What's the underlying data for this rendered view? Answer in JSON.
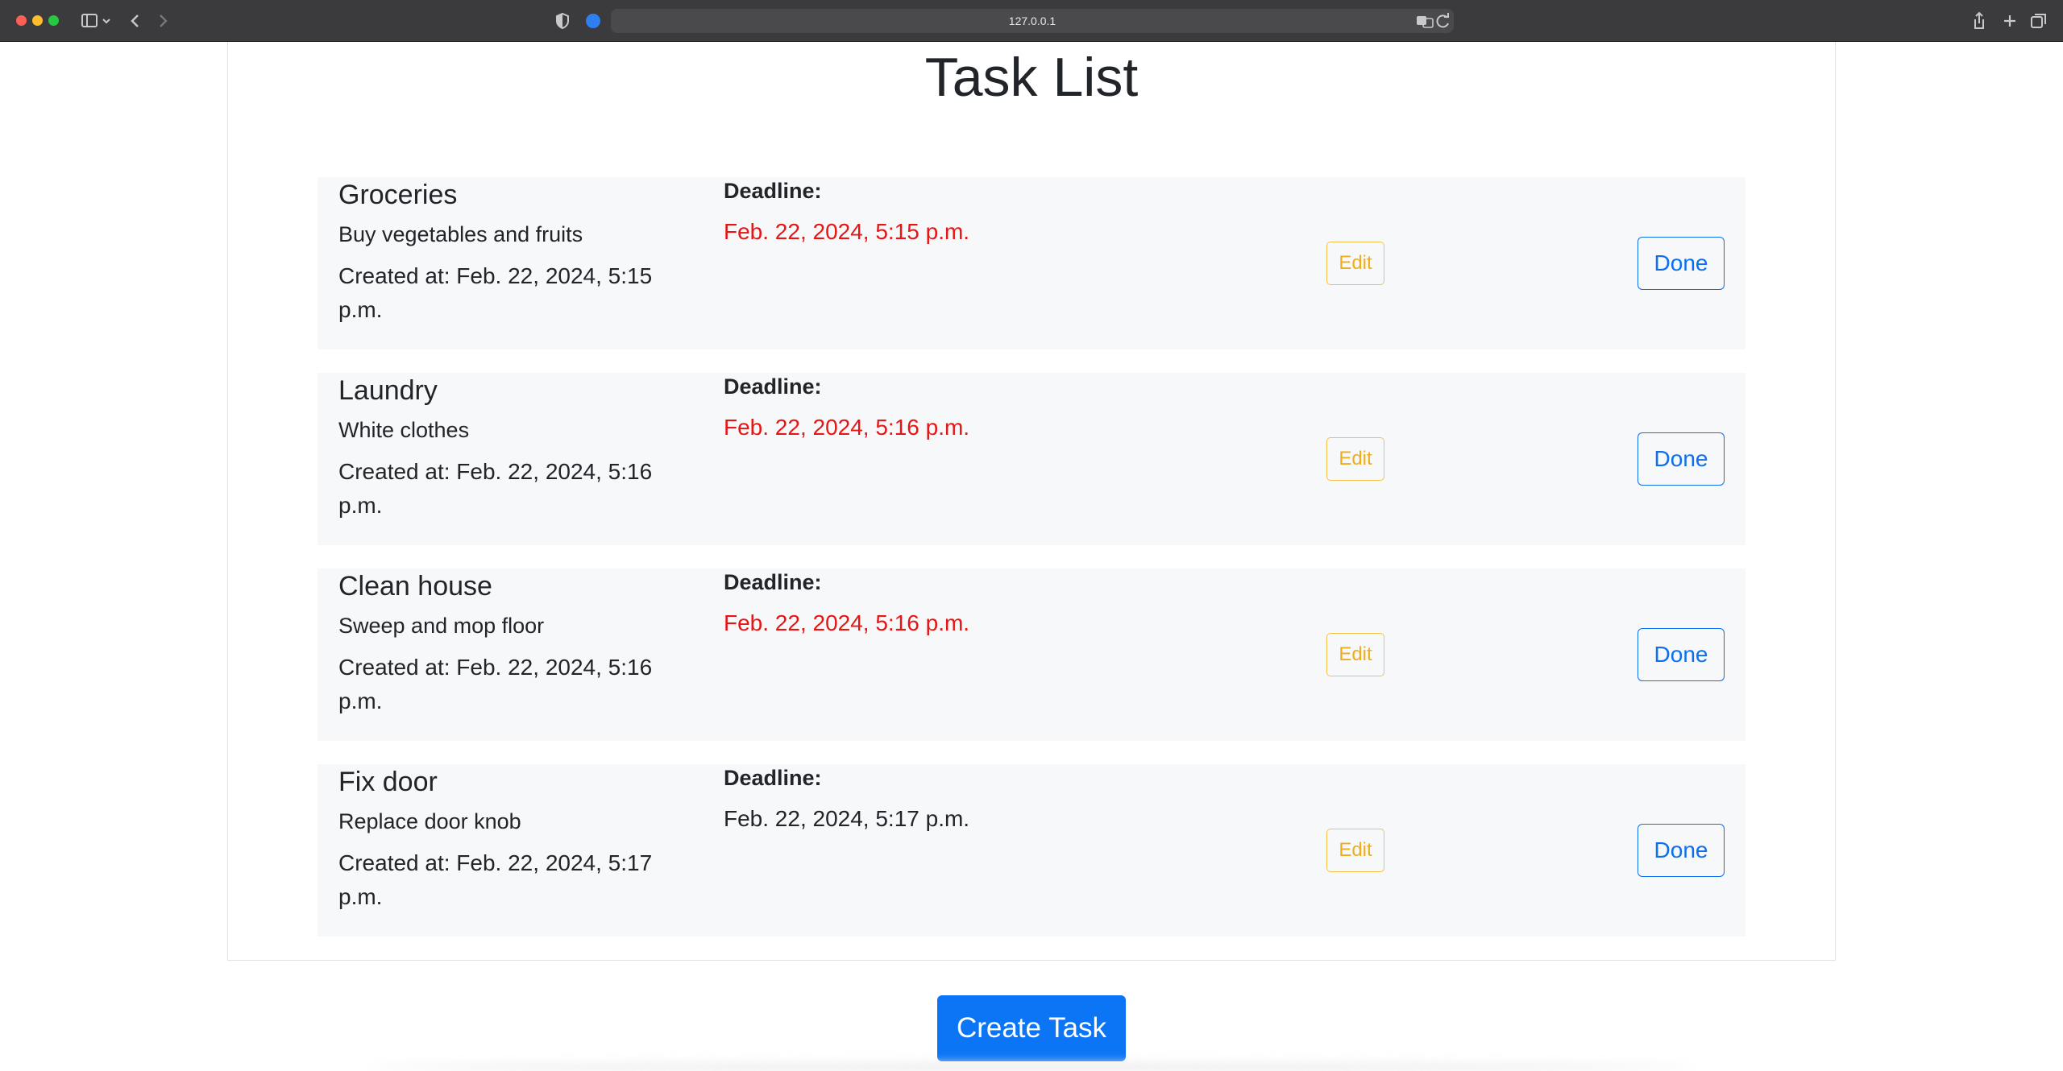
{
  "browser": {
    "url": "127.0.0.1",
    "icons": {
      "sidebar": "sidebar-icon",
      "back": "chevron-left-icon",
      "forward": "chevron-right-icon",
      "privacy": "shield-icon",
      "translate": "translate-icon",
      "reload": "reload-icon",
      "share": "share-icon",
      "new_tab": "plus-icon",
      "tab_overview": "tabs-icon"
    }
  },
  "page": {
    "title": "Task List",
    "create_button_label": "Create Task"
  },
  "tasks": [
    {
      "title": "Groceries",
      "description": "Buy vegetables and fruits",
      "created": "Created at: Feb. 22, 2024, 5:15 p.m.",
      "deadline_label": "Deadline:",
      "deadline": "Feb. 22, 2024, 5:15 p.m.",
      "overdue": true,
      "edit_label": "Edit",
      "done_label": "Done"
    },
    {
      "title": "Laundry",
      "description": "White clothes",
      "created": "Created at: Feb. 22, 2024, 5:16 p.m.",
      "deadline_label": "Deadline:",
      "deadline": "Feb. 22, 2024, 5:16 p.m.",
      "overdue": true,
      "edit_label": "Edit",
      "done_label": "Done"
    },
    {
      "title": "Clean house",
      "description": "Sweep and mop floor",
      "created": "Created at: Feb. 22, 2024, 5:16 p.m.",
      "deadline_label": "Deadline:",
      "deadline": "Feb. 22, 2024, 5:16 p.m.",
      "overdue": true,
      "edit_label": "Edit",
      "done_label": "Done"
    },
    {
      "title": "Fix door",
      "description": "Replace door knob",
      "created": "Created at: Feb. 22, 2024, 5:17 p.m.",
      "deadline_label": "Deadline:",
      "deadline": "Feb. 22, 2024, 5:17 p.m.",
      "overdue": false,
      "edit_label": "Edit",
      "done_label": "Done"
    }
  ],
  "colors": {
    "overdue": "#e81515",
    "primary": "#0b75f5",
    "warning": "#f0ad1a",
    "row_background": "#f7f8fa"
  }
}
